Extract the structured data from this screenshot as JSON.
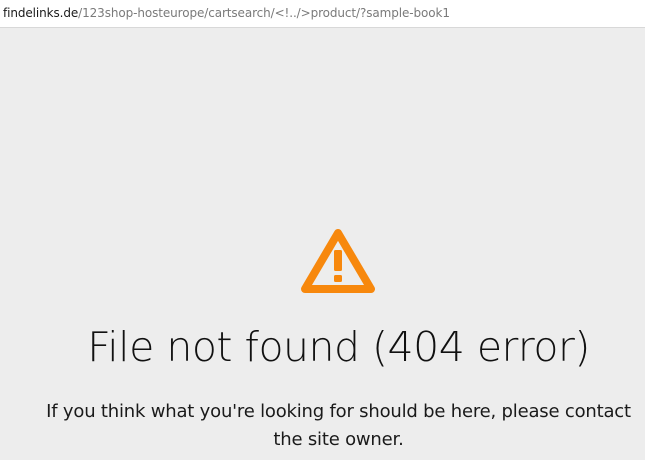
{
  "address_bar": {
    "host": "findelinks.de",
    "path": "/123shop-hosteurope/cartsearch/<!../>product/?sample-book1"
  },
  "icons": {
    "warning": "warning-triangle-icon"
  },
  "error": {
    "title": "File not found (404 error)",
    "message": "If you think what you're looking for should be here, please contact the site owner."
  },
  "colors": {
    "background": "#ededed",
    "warning": "#f7880d"
  }
}
